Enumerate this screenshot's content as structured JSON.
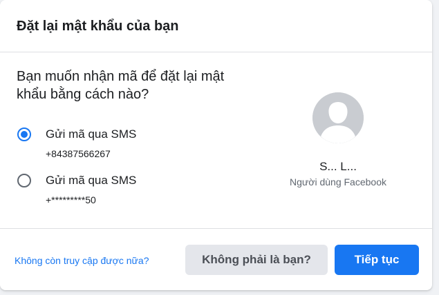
{
  "dialog": {
    "title": "Đặt lại mật khẩu của bạn",
    "question": "Bạn muốn nhận mã để đặt lại mật khẩu bằng cách nào?"
  },
  "options": [
    {
      "label": "Gửi mã qua SMS",
      "number": "+84387566267",
      "selected": true
    },
    {
      "label": "Gửi mã qua SMS",
      "number": "+*********50",
      "selected": false
    }
  ],
  "profile": {
    "name": "S... L...",
    "subtitle": "Người dùng Facebook",
    "avatar_icon": "default-avatar-icon"
  },
  "footer": {
    "no_access_link": "Không còn truy cập được nữa?",
    "not_you_button": "Không phải là bạn?",
    "continue_button": "Tiếp tục"
  },
  "colors": {
    "accent": "#1877f2",
    "secondary_button_bg": "#e4e6eb",
    "avatar_bg": "#c9ccd1"
  }
}
